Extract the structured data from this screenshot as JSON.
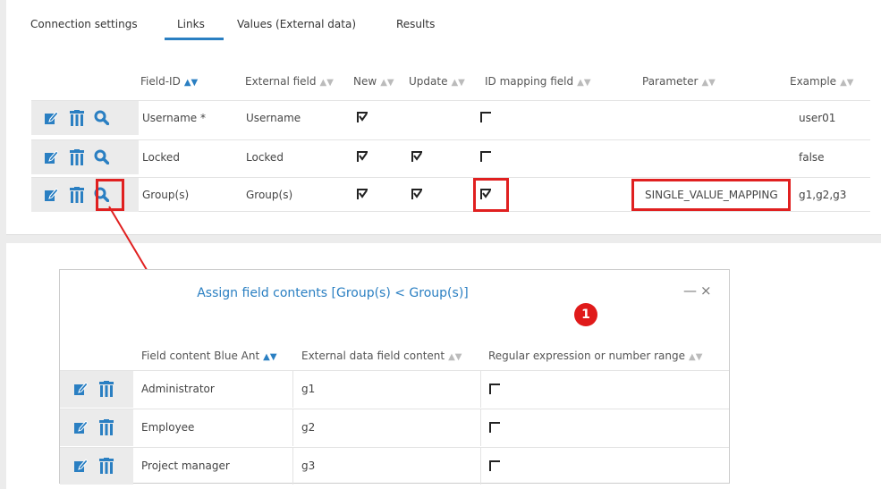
{
  "tabs": [
    {
      "label": "Connection settings"
    },
    {
      "label": "Links"
    },
    {
      "label": "Values (External data)"
    },
    {
      "label": "Results"
    }
  ],
  "active_tab": "Links",
  "links_table": {
    "columns": [
      {
        "label": "Field-ID",
        "sort": "active"
      },
      {
        "label": "External field",
        "sort": "inactive"
      },
      {
        "label": "New",
        "sort": "inactive"
      },
      {
        "label": "Update",
        "sort": "inactive"
      },
      {
        "label": "ID mapping field",
        "sort": "inactive"
      },
      {
        "label": "Parameter",
        "sort": "inactive"
      },
      {
        "label": "Example",
        "sort": "inactive"
      }
    ],
    "rows": [
      {
        "field_id": "Username *",
        "external_field": "Username",
        "new": true,
        "update": false,
        "id_mapping": false,
        "parameter": "",
        "example": "user01"
      },
      {
        "field_id": "Locked",
        "external_field": "Locked",
        "new": true,
        "update": true,
        "id_mapping": false,
        "parameter": "",
        "example": "false"
      },
      {
        "field_id": "Group(s)",
        "external_field": "Group(s)",
        "new": true,
        "update": true,
        "id_mapping": true,
        "parameter": "SINGLE_VALUE_MAPPING",
        "example": "g1,g2,g3"
      }
    ]
  },
  "popup": {
    "title": "Assign field contents [Group(s) < Group(s)]",
    "minimize_label": "—",
    "close_label": "×",
    "badge": "1",
    "columns": [
      {
        "label": "Field content Blue Ant",
        "sort": "active"
      },
      {
        "label": "External data field content",
        "sort": "inactive"
      },
      {
        "label": "Regular expression or number range",
        "sort": "inactive"
      }
    ],
    "rows": [
      {
        "content": "Administrator",
        "external": "g1",
        "regex": false
      },
      {
        "content": "Employee",
        "external": "g2",
        "regex": false
      },
      {
        "content": "Project manager",
        "external": "g3",
        "regex": false
      }
    ]
  },
  "icons": {
    "edit": "edit-icon",
    "delete": "trash-icon",
    "details": "magnifier-icon",
    "sort_active": "sort-arrow-icon",
    "sort_inactive": "sort-both-icon"
  },
  "colors": {
    "accent": "#2a7fc2",
    "highlight": "#e02020",
    "badge": "#e01a1a",
    "action_cell_bg": "#ebebeb"
  },
  "glyphs": {
    "sort_active": "▲▼",
    "sort_inactive": "▲▼"
  }
}
